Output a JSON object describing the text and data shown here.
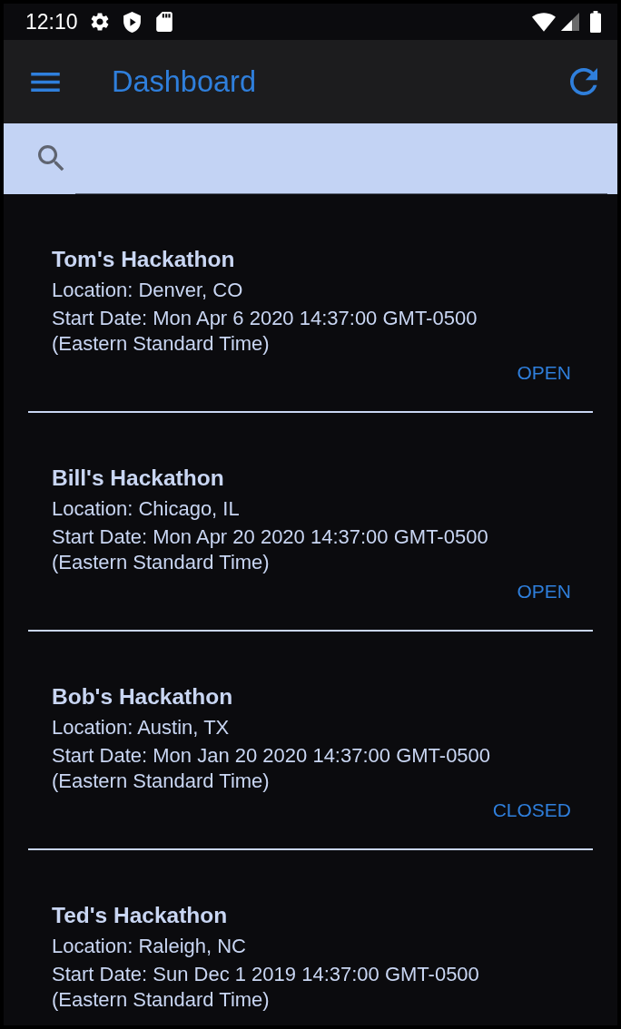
{
  "status_bar": {
    "time": "12:10"
  },
  "app_bar": {
    "title": "Dashboard"
  },
  "hackathons": [
    {
      "name": "Tom's Hackathon",
      "location": "Location: Denver, CO",
      "start_date": "Start Date: Mon Apr 6 2020 14:37:00 GMT-0500 (Eastern Standard Time)",
      "status": "OPEN"
    },
    {
      "name": "Bill's Hackathon",
      "location": "Location: Chicago, IL",
      "start_date": "Start Date: Mon Apr 20 2020 14:37:00 GMT-0500 (Eastern Standard Time)",
      "status": "OPEN"
    },
    {
      "name": "Bob's Hackathon",
      "location": "Location: Austin, TX",
      "start_date": "Start Date: Mon Jan 20 2020 14:37:00 GMT-0500 (Eastern Standard Time)",
      "status": "CLOSED"
    },
    {
      "name": "Ted's Hackathon",
      "location": "Location: Raleigh, NC",
      "start_date": "Start Date: Sun Dec 1 2019 14:37:00 GMT-0500 (Eastern Standard Time)"
    }
  ]
}
